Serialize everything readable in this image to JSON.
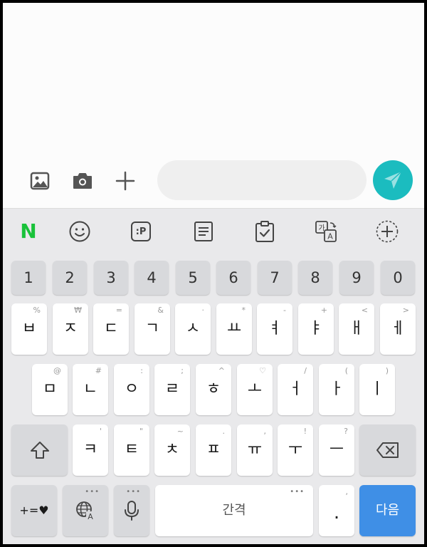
{
  "composer": {
    "message_placeholder": "",
    "icons": [
      "image-icon",
      "camera-icon",
      "plus-icon",
      "send-icon"
    ],
    "send_color": "#1bbcbf"
  },
  "keyboard": {
    "toolbar": {
      "naver_label": "N",
      "sticker_label": ":P",
      "icons": [
        "emoji-icon",
        "sticker-icon",
        "memo-icon",
        "clipboard-icon",
        "translate-icon",
        "add-tool-icon"
      ]
    },
    "number_row": [
      "1",
      "2",
      "3",
      "4",
      "5",
      "6",
      "7",
      "8",
      "9",
      "0"
    ],
    "row1": [
      {
        "main": "ㅂ",
        "hint": "%"
      },
      {
        "main": "ㅈ",
        "hint": "₩"
      },
      {
        "main": "ㄷ",
        "hint": "="
      },
      {
        "main": "ㄱ",
        "hint": "&"
      },
      {
        "main": "ㅅ",
        "hint": "·"
      },
      {
        "main": "ㅛ",
        "hint": "*"
      },
      {
        "main": "ㅕ",
        "hint": "-"
      },
      {
        "main": "ㅑ",
        "hint": "+"
      },
      {
        "main": "ㅐ",
        "hint": "<"
      },
      {
        "main": "ㅔ",
        "hint": ">"
      }
    ],
    "row2": [
      {
        "main": "ㅁ",
        "hint": "@"
      },
      {
        "main": "ㄴ",
        "hint": "#"
      },
      {
        "main": "ㅇ",
        "hint": ":"
      },
      {
        "main": "ㄹ",
        "hint": ";"
      },
      {
        "main": "ㅎ",
        "hint": "^"
      },
      {
        "main": "ㅗ",
        "hint": "♡"
      },
      {
        "main": "ㅓ",
        "hint": "/"
      },
      {
        "main": "ㅏ",
        "hint": "("
      },
      {
        "main": "ㅣ",
        "hint": ")"
      }
    ],
    "row3": [
      {
        "main": "ㅋ",
        "hint": "'"
      },
      {
        "main": "ㅌ",
        "hint": "\""
      },
      {
        "main": "ㅊ",
        "hint": "~"
      },
      {
        "main": "ㅍ",
        "hint": "."
      },
      {
        "main": "ㅠ",
        "hint": ","
      },
      {
        "main": "ㅜ",
        "hint": "!"
      },
      {
        "main": "ㅡ",
        "hint": "?"
      }
    ],
    "bottom": {
      "symbols_label": "+=♥",
      "space_label": "간격",
      "period_label": ".",
      "period_hint": ",",
      "next_label": "다음",
      "dots": "•••"
    },
    "next_color": "#3f8fe6"
  }
}
